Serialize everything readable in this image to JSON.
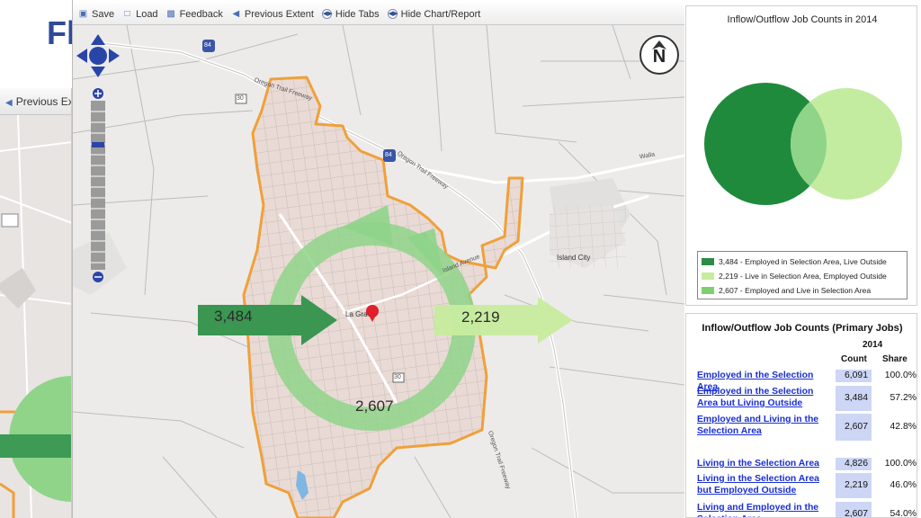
{
  "slide": {
    "title_fragment": "Fl"
  },
  "left_app": {
    "toolbar_label": "Previous Ex"
  },
  "toolbar": {
    "save": "Save",
    "load": "Load",
    "feedback": "Feedback",
    "previous_extent": "Previous Extent",
    "hide_tabs": "Hide Tabs",
    "hide_chart_report": "Hide Chart/Report"
  },
  "map": {
    "town_center_label": "La Gra",
    "other_town_label": "Island City",
    "road_labels": [
      "Oregon Trail Freeway",
      "Oregon Trail Freeway",
      "Island Avenue",
      "Oregon Trail Freeway",
      "Walla"
    ],
    "route_shields": [
      "84",
      "84",
      "30",
      "30"
    ],
    "flows": {
      "inflow": "3,484",
      "outflow": "2,219",
      "internal": "2,607"
    },
    "north_letter": "N"
  },
  "venn": {
    "title": "Inflow/Outflow Job Counts in 2014",
    "legend": [
      {
        "text": "3,484 - Employed in Selection Area, Live Outside",
        "color": "#2e8b45"
      },
      {
        "text": "2,219 - Live in Selection Area, Employed Outside",
        "color": "#c7ec9e"
      },
      {
        "text": "2,607 - Employed and Live in Selection Area",
        "color": "#7fcf72"
      }
    ],
    "colors": {
      "employed": "#1f8a3b",
      "live": "#c4eca0",
      "overlap": "#8fd489"
    }
  },
  "table": {
    "title": "Inflow/Outflow Job Counts (Primary Jobs)",
    "year": "2014",
    "col_count": "Count",
    "col_share": "Share",
    "rows": [
      {
        "label": "Employed in the Selection Area",
        "count": "6,091",
        "share": "100.0%"
      },
      {
        "label": "Employed in the Selection Area but Living Outside",
        "count": "3,484",
        "share": "57.2%"
      },
      {
        "label": "Employed and Living in the Selection Area",
        "count": "2,607",
        "share": "42.8%"
      },
      {
        "label": "Living in the Selection Area",
        "count": "4,826",
        "share": "100.0%"
      },
      {
        "label": "Living in the Selection Area but Employed Outside",
        "count": "2,219",
        "share": "46.0%"
      },
      {
        "label": "Living and Employed in the Selection Area",
        "count": "2,607",
        "share": "54.0%"
      }
    ]
  },
  "colors": {
    "boundary": "#f0a03a",
    "link": "#1a2fd4",
    "accent": "#4a6fb5",
    "marker": "#e0202a"
  }
}
